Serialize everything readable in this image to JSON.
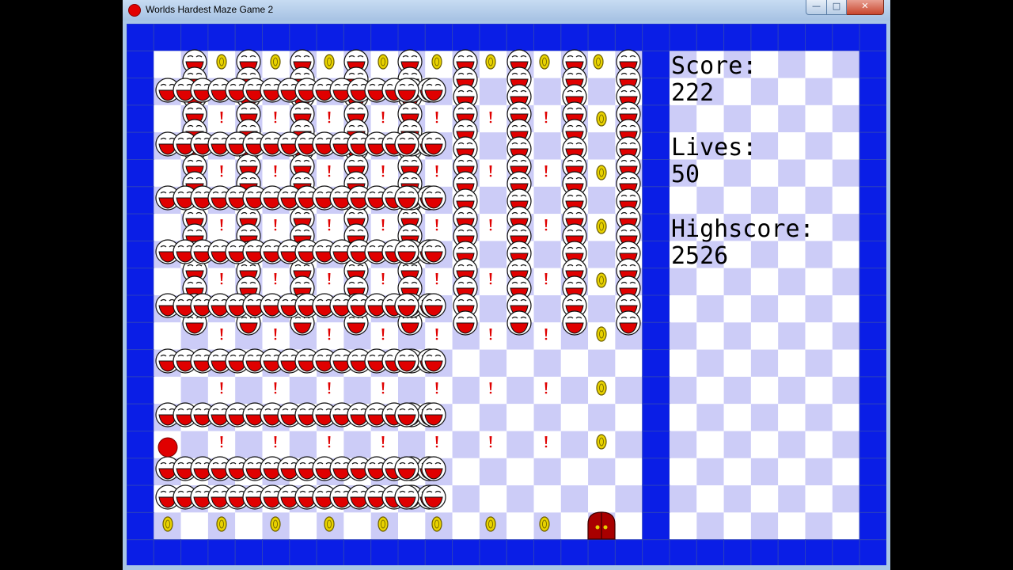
{
  "window": {
    "title": "Worlds Hardest Maze Game 2",
    "controls": {
      "minimize": "—",
      "maximize": "□",
      "close": "✕"
    }
  },
  "hud": {
    "score_label": "Score:",
    "score_value": "222",
    "lives_label": "Lives:",
    "lives_value": "50",
    "highscore_label": "Highscore:",
    "highscore_value": "2526"
  },
  "icons": {
    "app": "red-ball-icon",
    "player": "red-ball",
    "enemy": "laughing-smiley",
    "coin": "gold-coin",
    "key": "red-exclamation-key",
    "exit": "red-door"
  },
  "colors": {
    "wall": "#0a1ee6",
    "floor_light": "#ffffff",
    "floor_dark": "#ccccf7",
    "player": "#e00000",
    "coin": "#e8d200",
    "door": "#a80000"
  }
}
